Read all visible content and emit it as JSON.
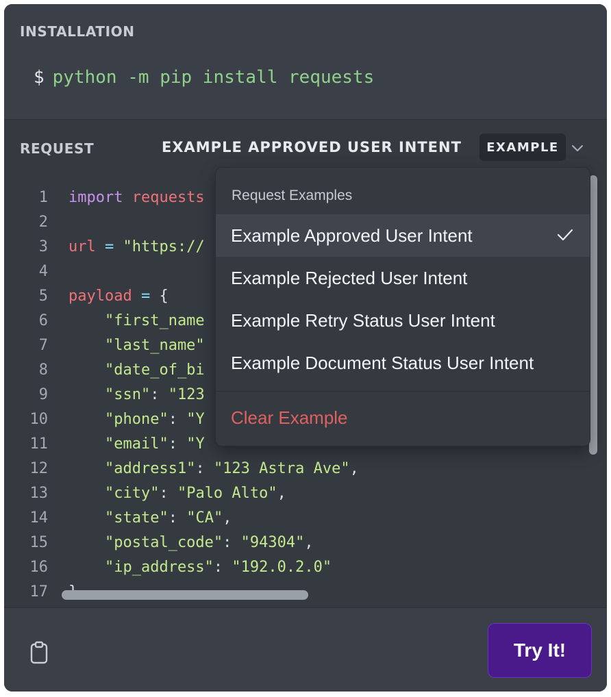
{
  "installation": {
    "title": "INSTALLATION",
    "prompt": "$",
    "command": "python -m pip install requests"
  },
  "request": {
    "title": "REQUEST",
    "selected_example": "EXAMPLE APPROVED USER INTENT",
    "badge": "EXAMPLE"
  },
  "code_lines": [
    {
      "n": "1",
      "parts": [
        [
          "kw",
          "import "
        ],
        [
          "mod",
          "requests"
        ]
      ]
    },
    {
      "n": "2",
      "parts": []
    },
    {
      "n": "3",
      "parts": [
        [
          "var",
          "url"
        ],
        [
          "op",
          " = "
        ],
        [
          "str",
          "\"https://"
        ]
      ]
    },
    {
      "n": "4",
      "parts": []
    },
    {
      "n": "5",
      "parts": [
        [
          "var",
          "payload"
        ],
        [
          "op",
          " = "
        ],
        [
          "pun",
          "{"
        ]
      ]
    },
    {
      "n": "6",
      "parts": [
        [
          "str",
          "    \"first_name"
        ]
      ]
    },
    {
      "n": "7",
      "parts": [
        [
          "str",
          "    \"last_name\""
        ]
      ]
    },
    {
      "n": "8",
      "parts": [
        [
          "str",
          "    \"date_of_bi"
        ]
      ]
    },
    {
      "n": "9",
      "parts": [
        [
          "str",
          "    \"ssn\""
        ],
        [
          "pun",
          ": "
        ],
        [
          "str",
          "\"123"
        ]
      ]
    },
    {
      "n": "10",
      "parts": [
        [
          "str",
          "    \"phone\""
        ],
        [
          "pun",
          ": "
        ],
        [
          "str",
          "\"Y"
        ]
      ]
    },
    {
      "n": "11",
      "parts": [
        [
          "str",
          "    \"email\""
        ],
        [
          "pun",
          ": "
        ],
        [
          "str",
          "\"Y"
        ]
      ]
    },
    {
      "n": "12",
      "parts": [
        [
          "str",
          "    \"address1\""
        ],
        [
          "pun",
          ": "
        ],
        [
          "str",
          "\"123 Astra Ave\""
        ],
        [
          "pun",
          ","
        ]
      ]
    },
    {
      "n": "13",
      "parts": [
        [
          "str",
          "    \"city\""
        ],
        [
          "pun",
          ": "
        ],
        [
          "str",
          "\"Palo Alto\""
        ],
        [
          "pun",
          ","
        ]
      ]
    },
    {
      "n": "14",
      "parts": [
        [
          "str",
          "    \"state\""
        ],
        [
          "pun",
          ": "
        ],
        [
          "str",
          "\"CA\""
        ],
        [
          "pun",
          ","
        ]
      ]
    },
    {
      "n": "15",
      "parts": [
        [
          "str",
          "    \"postal_code\""
        ],
        [
          "pun",
          ": "
        ],
        [
          "str",
          "\"94304\""
        ],
        [
          "pun",
          ","
        ]
      ]
    },
    {
      "n": "16",
      "parts": [
        [
          "str",
          "    \"ip_address\""
        ],
        [
          "pun",
          ": "
        ],
        [
          "str",
          "\"192.0.2.0\""
        ]
      ]
    },
    {
      "n": "17",
      "parts": [
        [
          "pun",
          "}"
        ]
      ]
    }
  ],
  "dropdown": {
    "header": "Request Examples",
    "items": [
      {
        "label": "Example Approved User Intent",
        "selected": true
      },
      {
        "label": "Example Rejected User Intent",
        "selected": false
      },
      {
        "label": "Example Retry Status User Intent",
        "selected": false
      },
      {
        "label": "Example Document Status User Intent",
        "selected": false
      }
    ],
    "clear_label": "Clear Example"
  },
  "footer": {
    "try_label": "Try It!"
  },
  "colors": {
    "panel": "#3b4048",
    "code_bg": "#353a41",
    "try_button": "#4b1a8a",
    "clear": "#e0605f",
    "string": "#c3e88d",
    "keyword": "#c792ea"
  },
  "icons": {
    "copy": "clipboard-icon",
    "chevron": "chevron-down-icon",
    "selected": "checkmark-icon"
  }
}
